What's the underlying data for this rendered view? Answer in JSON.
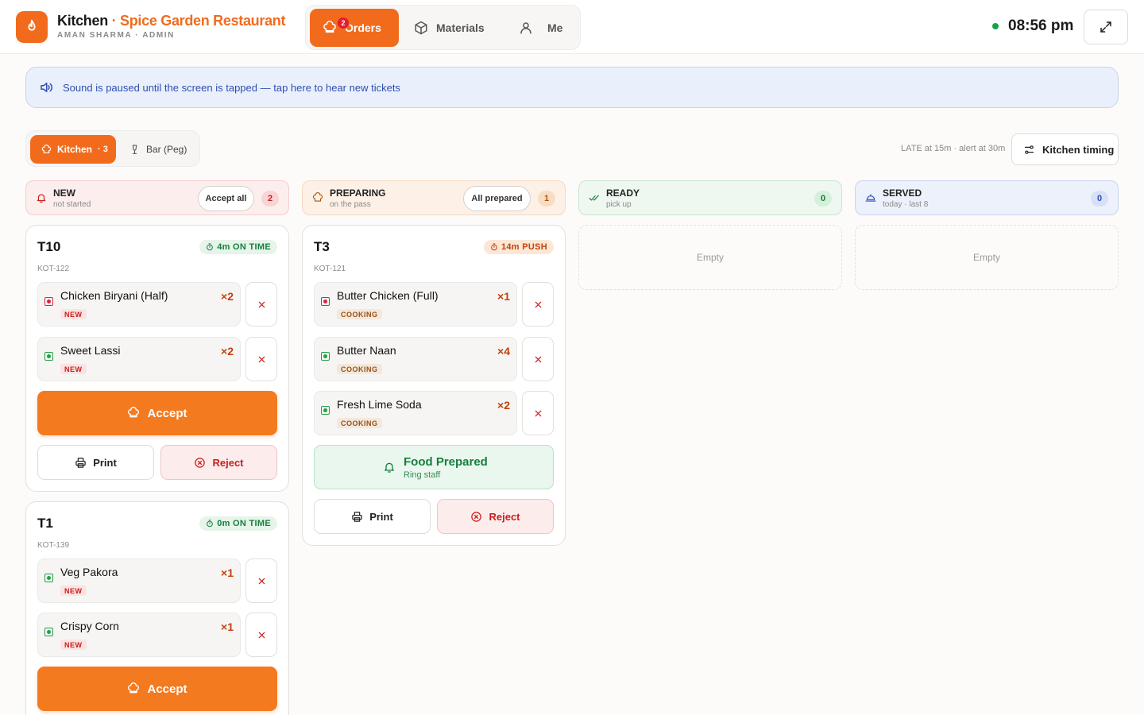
{
  "header": {
    "app_name": "Kitchen",
    "separator": " · ",
    "restaurant": "Spice Garden Restaurant",
    "user_line": "AMAN SHARMA · ADMIN",
    "nav": {
      "orders": "Orders",
      "orders_badge": "2",
      "materials": "Materials",
      "me": "Me"
    },
    "clock": "08:56 pm"
  },
  "banner": {
    "text": "Sound is paused until the screen is tapped — tap here to hear new tickets"
  },
  "stations": {
    "kitchen": "Kitchen",
    "kitchen_count": "· 3",
    "bar": "Bar (Peg)"
  },
  "timing": {
    "info": "LATE at 15m · alert at 30m",
    "button": "Kitchen timing"
  },
  "columns": {
    "new": {
      "title": "NEW",
      "sub": "not started",
      "bulk": "Accept all",
      "count": "2"
    },
    "preparing": {
      "title": "PREPARING",
      "sub": "on the pass",
      "bulk": "All prepared",
      "count": "1"
    },
    "ready": {
      "title": "READY",
      "sub": "pick up",
      "count": "0",
      "empty": "Empty"
    },
    "served": {
      "title": "SERVED",
      "sub": "today · last 8",
      "count": "0",
      "empty": "Empty"
    }
  },
  "tickets": {
    "t10": {
      "table": "T10",
      "kot": "KOT-122",
      "timer": "4m ON TIME",
      "items": [
        {
          "name": "Chicken Biryani (Half)",
          "qty": "×2",
          "status": "NEW",
          "type": "non-veg"
        },
        {
          "name": "Sweet Lassi",
          "qty": "×2",
          "status": "NEW",
          "type": "veg"
        }
      ],
      "accept": "Accept",
      "print": "Print",
      "reject": "Reject"
    },
    "t1": {
      "table": "T1",
      "kot": "KOT-139",
      "timer": "0m ON TIME",
      "items": [
        {
          "name": "Veg Pakora",
          "qty": "×1",
          "status": "NEW",
          "type": "veg"
        },
        {
          "name": "Crispy Corn",
          "qty": "×1",
          "status": "NEW",
          "type": "veg"
        }
      ],
      "accept": "Accept"
    },
    "t3": {
      "table": "T3",
      "kot": "KOT-121",
      "timer": "14m PUSH",
      "items": [
        {
          "name": "Butter Chicken (Full)",
          "qty": "×1",
          "status": "COOKING",
          "type": "non-veg"
        },
        {
          "name": "Butter Naan",
          "qty": "×4",
          "status": "COOKING",
          "type": "veg"
        },
        {
          "name": "Fresh Lime Soda",
          "qty": "×2",
          "status": "COOKING",
          "type": "veg"
        }
      ],
      "prepared_title": "Food Prepared",
      "prepared_sub": "Ring staff",
      "print": "Print",
      "reject": "Reject"
    }
  },
  "colors": {
    "accent": "#f26b1d",
    "accept": "#f47a1f",
    "danger": "#c81e1e",
    "success": "#15803d",
    "info": "#2c4fb0"
  }
}
